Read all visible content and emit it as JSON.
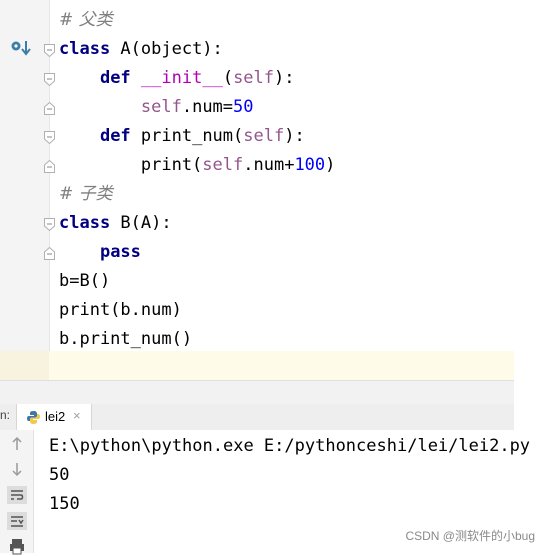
{
  "editor": {
    "lines": [
      {
        "parts": [
          {
            "t": "# 父类",
            "c": "cm"
          }
        ]
      },
      {
        "parts": [
          {
            "t": "class",
            "c": "kw"
          },
          {
            "t": " A(object):",
            "c": ""
          }
        ]
      },
      {
        "parts": [
          {
            "t": "    ",
            "c": ""
          },
          {
            "t": "def",
            "c": "kw"
          },
          {
            "t": " ",
            "c": ""
          },
          {
            "t": "__init__",
            "c": "magic"
          },
          {
            "t": "(",
            "c": ""
          },
          {
            "t": "self",
            "c": "slf"
          },
          {
            "t": "):",
            "c": ""
          }
        ]
      },
      {
        "parts": [
          {
            "t": "        ",
            "c": ""
          },
          {
            "t": "self",
            "c": "slf"
          },
          {
            "t": ".num=",
            "c": ""
          },
          {
            "t": "50",
            "c": "num"
          }
        ]
      },
      {
        "parts": [
          {
            "t": "    ",
            "c": ""
          },
          {
            "t": "def",
            "c": "kw"
          },
          {
            "t": " print_num(",
            "c": ""
          },
          {
            "t": "self",
            "c": "slf"
          },
          {
            "t": "):",
            "c": ""
          }
        ]
      },
      {
        "parts": [
          {
            "t": "        print(",
            "c": ""
          },
          {
            "t": "self",
            "c": "slf"
          },
          {
            "t": ".num+",
            "c": ""
          },
          {
            "t": "100",
            "c": "num"
          },
          {
            "t": ")",
            "c": ""
          }
        ]
      },
      {
        "parts": [
          {
            "t": "# 子类",
            "c": "cm"
          }
        ]
      },
      {
        "parts": [
          {
            "t": "class",
            "c": "kw"
          },
          {
            "t": " B(A):",
            "c": ""
          }
        ]
      },
      {
        "parts": [
          {
            "t": "    ",
            "c": ""
          },
          {
            "t": "pass",
            "c": "kw"
          }
        ]
      },
      {
        "parts": [
          {
            "t": "b=B()",
            "c": ""
          }
        ]
      },
      {
        "parts": [
          {
            "t": "print(b.num)",
            "c": ""
          }
        ]
      },
      {
        "parts": [
          {
            "t": "b.print_num()",
            "c": ""
          }
        ]
      }
    ]
  },
  "run_panel": {
    "prefix": "n:",
    "tab_label": "lei2",
    "tab_close": "×",
    "output": [
      "E:\\python\\python.exe E:/pythonceshi/lei/lei2.py",
      "50",
      "150"
    ]
  },
  "watermark": "CSDN @测软件的小bug",
  "colors": {
    "keyword": "#000080",
    "comment": "#808080",
    "self": "#94558d",
    "number": "#0000ff",
    "magic": "#b200b2",
    "caret_line": "#fefbe8"
  }
}
